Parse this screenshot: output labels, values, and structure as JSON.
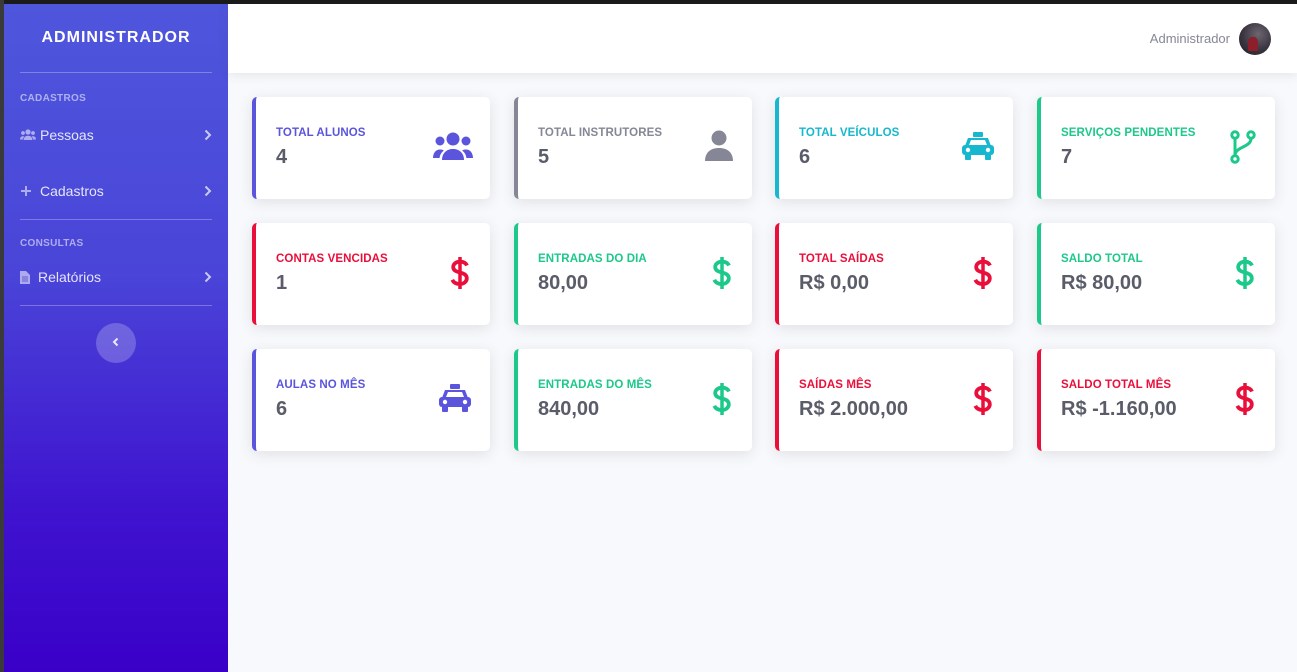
{
  "sidebar": {
    "brand": "ADMINISTRADOR",
    "sections": [
      {
        "heading": "CADASTROS",
        "items": [
          {
            "label": "Pessoas",
            "icon": "users-icon"
          },
          {
            "label": "Cadastros",
            "icon": "plus-icon"
          }
        ]
      },
      {
        "heading": "CONSULTAS",
        "items": [
          {
            "label": "Relatórios",
            "icon": "file-icon"
          }
        ]
      }
    ],
    "toggle_icon": "chevron-left-icon"
  },
  "topbar": {
    "user_name": "Administrador"
  },
  "colors": {
    "indigo": "#5a55dc",
    "gray": "#858796",
    "teal": "#17b8cf",
    "green": "#1cc88a",
    "red": "#ea0f3a"
  },
  "cards": [
    {
      "title": "TOTAL ALUNOS",
      "value": "4",
      "color": "#5a55dc",
      "icon": "users-icon"
    },
    {
      "title": "TOTAL INSTRUTORES",
      "value": "5",
      "color": "#858796",
      "icon": "user-icon"
    },
    {
      "title": "TOTAL VEÍCULOS",
      "value": "6",
      "color": "#17b8cf",
      "icon": "taxi-icon"
    },
    {
      "title": "SERVIÇOS PENDENTES",
      "value": "7",
      "color": "#1cc88a",
      "icon": "code-branch-icon"
    },
    {
      "title": "CONTAS VENCIDAS",
      "value": "1",
      "color": "#ea0f3a",
      "icon": "dollar-icon"
    },
    {
      "title": "ENTRADAS DO DIA",
      "value": "80,00",
      "color": "#1cc88a",
      "icon": "dollar-icon"
    },
    {
      "title": "TOTAL SAÍDAS",
      "value": "R$ 0,00",
      "color": "#ea0f3a",
      "icon": "dollar-icon"
    },
    {
      "title": "SALDO TOTAL",
      "value": "R$ 80,00",
      "color": "#1cc88a",
      "icon": "dollar-icon"
    },
    {
      "title": "AULAS NO MÊS",
      "value": "6",
      "color": "#5a55dc",
      "icon": "taxi-icon"
    },
    {
      "title": "ENTRADAS DO MÊS",
      "value": "840,00",
      "color": "#1cc88a",
      "icon": "dollar-icon"
    },
    {
      "title": "SAÍDAS MÊS",
      "value": "R$ 2.000,00",
      "color": "#ea0f3a",
      "icon": "dollar-icon"
    },
    {
      "title": "SALDO TOTAL MÊS",
      "value": "R$ -1.160,00",
      "color": "#ea0f3a",
      "icon": "dollar-icon"
    }
  ]
}
